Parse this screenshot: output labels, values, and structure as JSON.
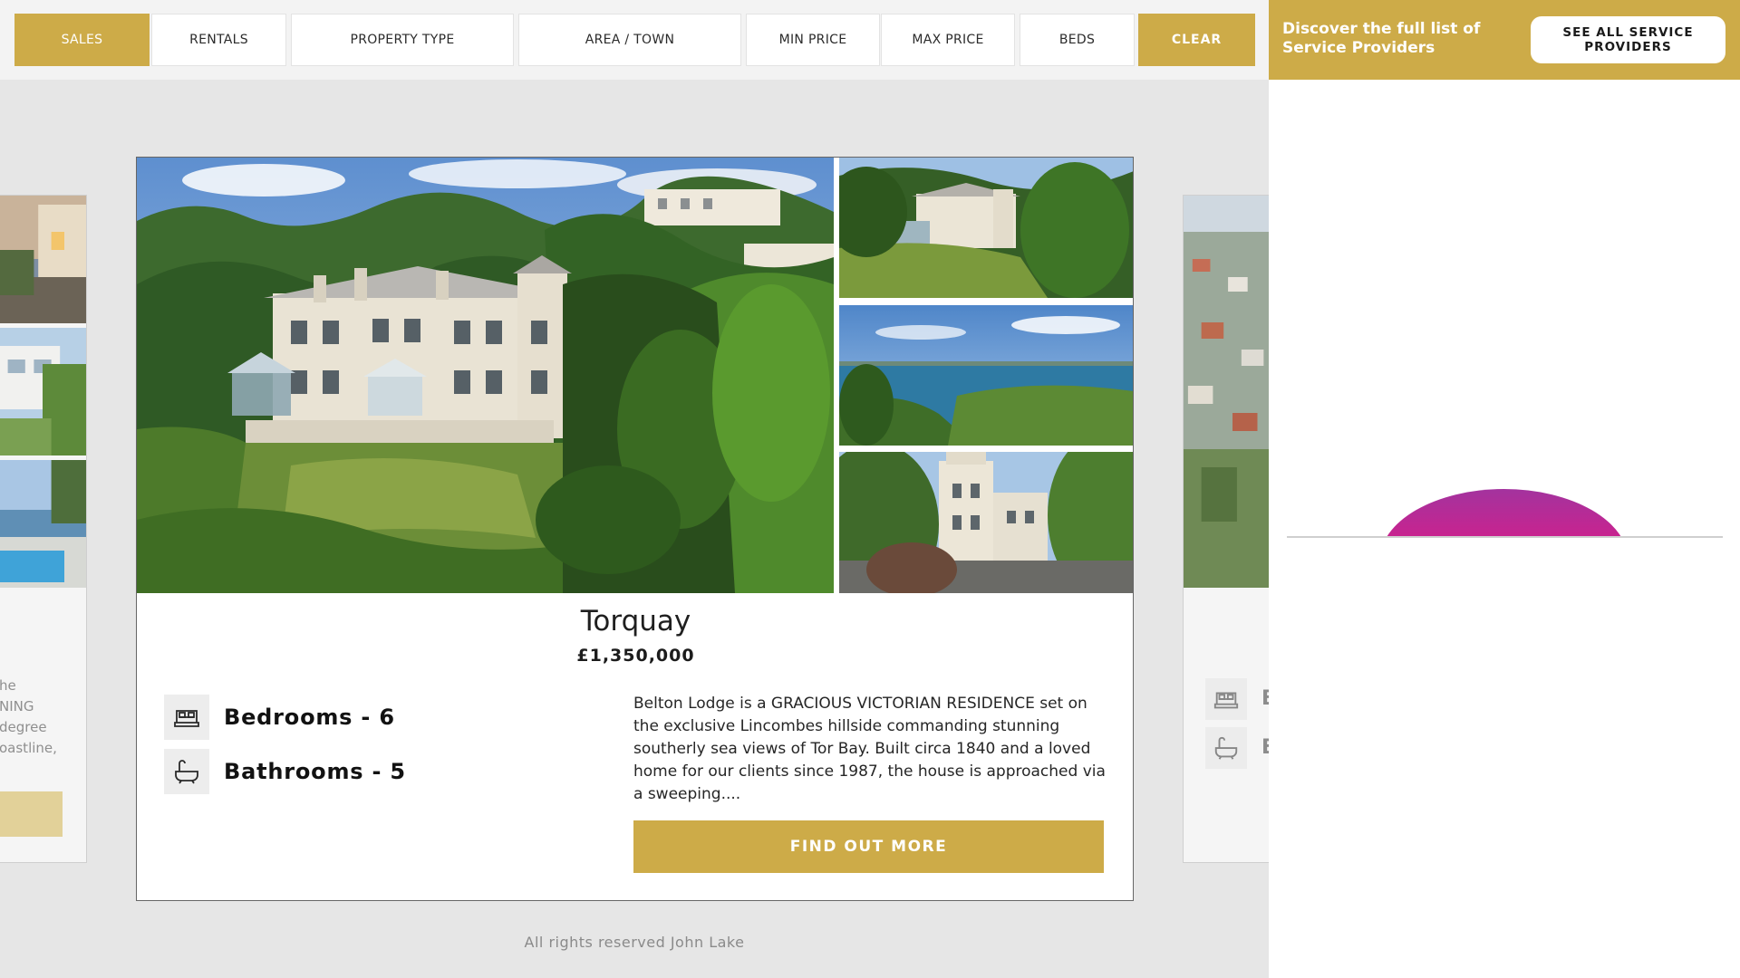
{
  "filters": {
    "sales": "SALES",
    "rentals": "RENTALS",
    "property_type": "PROPERTY TYPE",
    "area_town": "AREA / TOWN",
    "min_price": "MIN PRICE",
    "max_price": "MAX PRICE",
    "beds": "BEDS",
    "clear": "CLEAR",
    "active": "SALES"
  },
  "listing": {
    "town": "Torquay",
    "price": "£1,350,000",
    "bedrooms": "Bedrooms - 6",
    "bathrooms": "Bathrooms - 5",
    "description": "Belton Lodge is a GRACIOUS VICTORIAN RESIDENCE set on the exclusive Lincombes hillside commanding stunning southerly sea views of Tor Bay. Built circa 1840 and a loved home for our clients since 1987, the house is approached via a sweeping....",
    "cta": "FIND OUT MORE"
  },
  "side_left": {
    "text_lines": [
      "he",
      "NING",
      "degree",
      "oastline,"
    ]
  },
  "side_right": {
    "feature_letters": [
      "B",
      "B"
    ]
  },
  "footer": "All rights reserved John Lake",
  "promo": {
    "text": "Discover the full list of Service Providers",
    "button": "SEE ALL SERVICE PROVIDERS"
  },
  "colors": {
    "accent_gold": "#cdab48",
    "loader_gradient_top": "#a3339e",
    "loader_gradient_bottom": "#f2215f"
  },
  "icons": [
    "bed-icon",
    "bath-icon"
  ]
}
